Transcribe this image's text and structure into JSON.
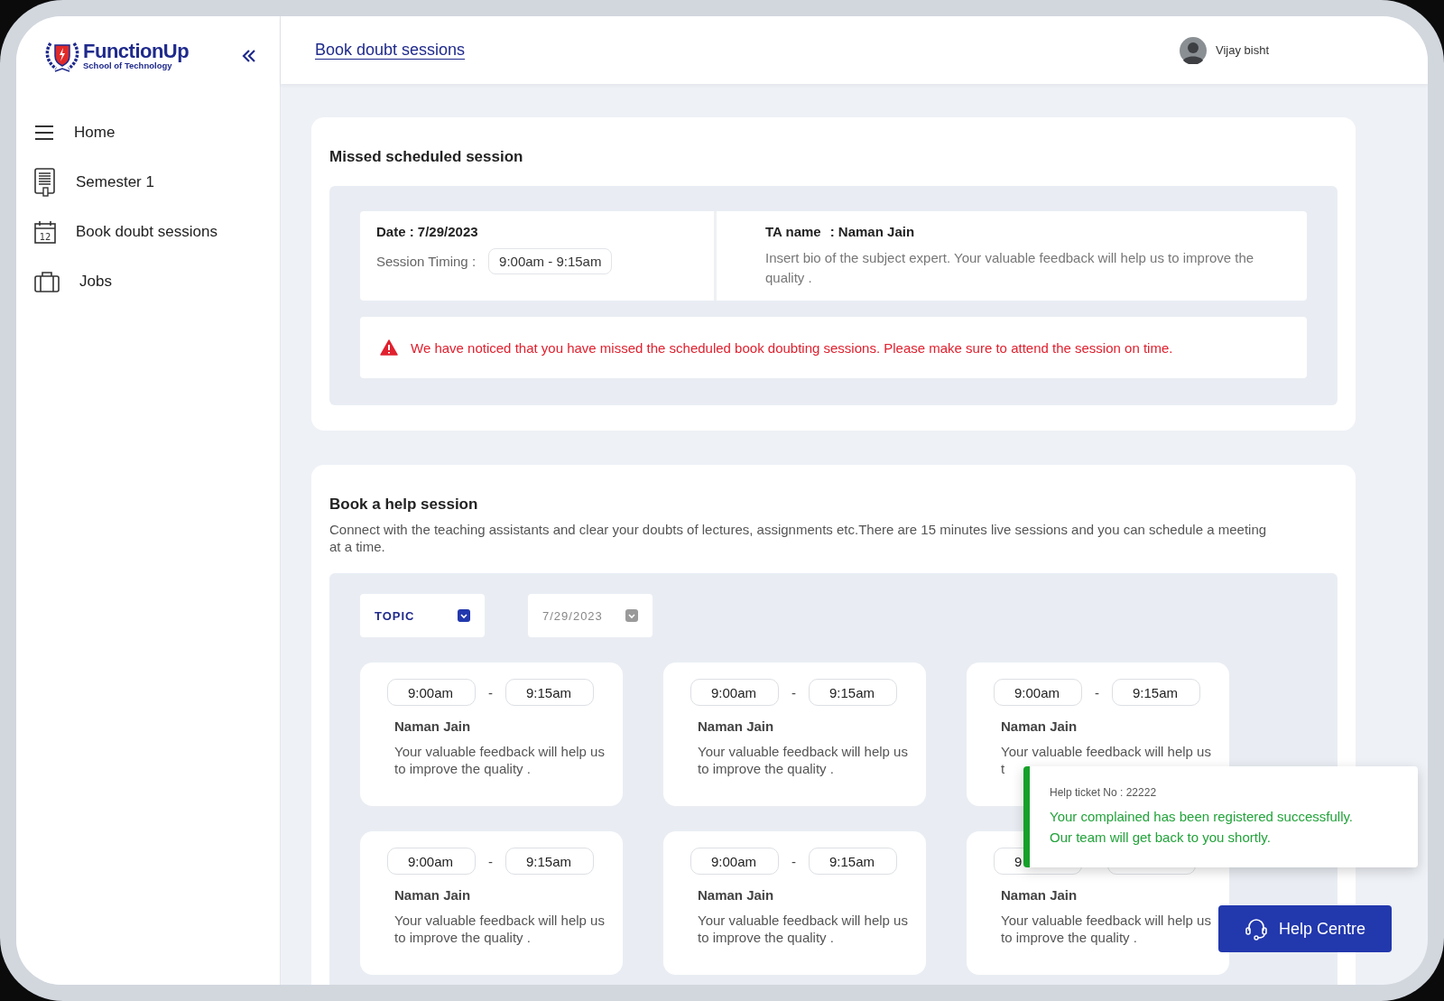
{
  "logo": {
    "name": "FunctionUp",
    "tagline": "School of Technology"
  },
  "sidebar": {
    "items": [
      {
        "kind": "menu",
        "label": "Home"
      },
      {
        "kind": "document",
        "label": "Semester 1"
      },
      {
        "kind": "calendar",
        "label": "Book doubt sessions",
        "calendar_day": "12"
      },
      {
        "kind": "briefcase",
        "label": "Jobs"
      }
    ]
  },
  "header": {
    "title": "Book doubt sessions",
    "user": "Vijay bisht"
  },
  "missed_session": {
    "title": "Missed scheduled session",
    "date_label": "Date : 7/29/2023",
    "timing_label": "Session Timing :",
    "timing": "9:00am - 9:15am",
    "ta_label": "TA name",
    "ta_name": ":  Naman Jain",
    "bio": "Insert bio of the subject expert. Your valuable feedback will help us to improve the quality .",
    "warning": "We have noticed that you have missed the scheduled  book doubting sessions. Please make sure to attend the session on time."
  },
  "help_session": {
    "title": "Book a help session",
    "description": "Connect with the teaching assistants and clear your doubts of lectures, assignments etc.There are 15 minutes live sessions and you can schedule a meeting at a time.",
    "filters": [
      {
        "label": "TOPIC",
        "selected": true
      },
      {
        "label": "7/29/2023",
        "selected": false
      }
    ],
    "slots": [
      {
        "start": "9:00am",
        "separator": "-",
        "end": "9:15am",
        "name": "Naman Jain",
        "description": "Your valuable feedback will help us to improve the quality ."
      },
      {
        "start": "9:00am",
        "separator": "-",
        "end": "9:15am",
        "name": "Naman Jain",
        "description": "Your valuable feedback will help us to improve the quality ."
      },
      {
        "start": "9:00am",
        "separator": "-",
        "end": "9:15am",
        "name": "Naman Jain",
        "description": "Your valuable feedback will help us t"
      },
      {
        "start": "9:00am",
        "separator": "-",
        "end": "9:15am",
        "name": "Naman Jain",
        "description": "Your valuable feedback will help us to improve the quality ."
      },
      {
        "start": "9:00am",
        "separator": "-",
        "end": "9:15am",
        "name": "Naman Jain",
        "description": "Your valuable feedback will help us to improve the quality ."
      },
      {
        "start": "9",
        "name": "Naman Jain",
        "description": "Your valuable feedback will help us to improve the quality ."
      }
    ]
  },
  "toast": {
    "ticket": "Help ticket No : 22222",
    "message": "Your complained has been registered successfully.",
    "message_2": "Our team will get back to you shortly."
  },
  "help_button": {
    "label": "Help Centre"
  }
}
